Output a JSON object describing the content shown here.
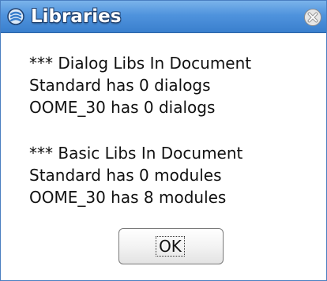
{
  "window": {
    "title": "Libraries"
  },
  "message": {
    "lines": [
      "*** Dialog Libs In Document",
      "Standard has 0 dialogs",
      "OOME_30 has 0 dialogs",
      "*** Basic Libs In Document",
      "Standard has 0 modules",
      "OOME_30 has 8 modules"
    ]
  },
  "buttons": {
    "ok_label": "OK"
  },
  "colors": {
    "titlebar": "#4f93dd",
    "title_text": "#ffffff",
    "title_outline": "#1e3f6e",
    "dialog_background": "#ffffff"
  },
  "icons": {
    "app": "app-menu-icon",
    "close": "close-icon"
  }
}
